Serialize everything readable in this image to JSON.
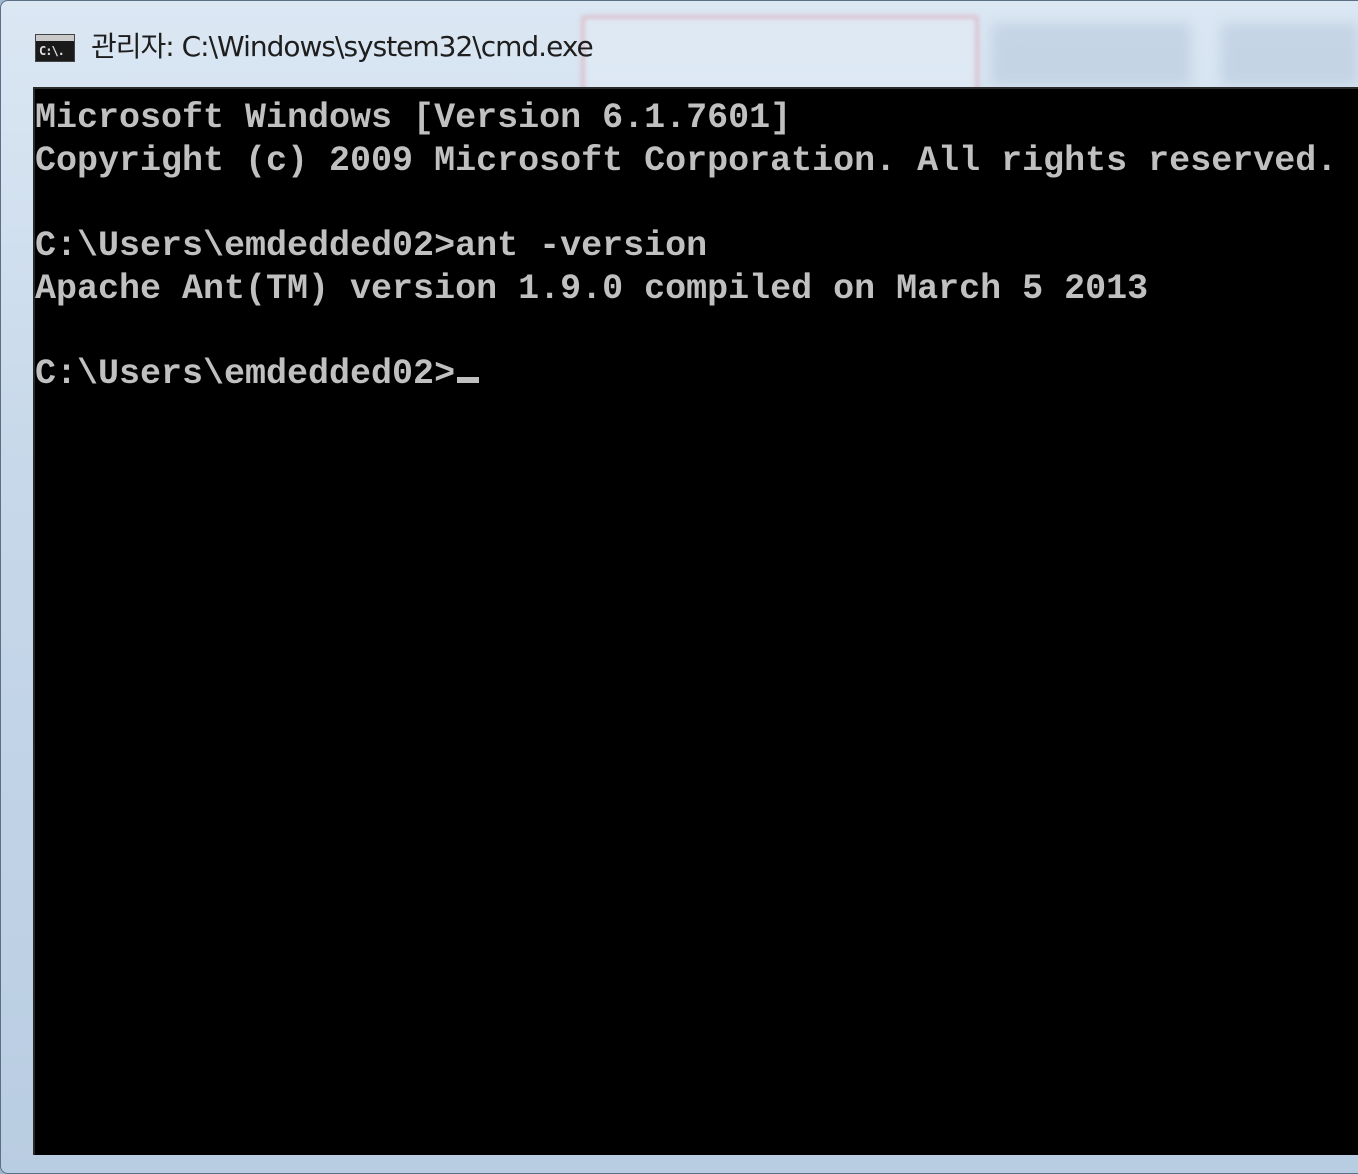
{
  "window": {
    "title": "관리자: C:\\Windows\\system32\\cmd.exe",
    "icon_text": "C:\\."
  },
  "console": {
    "lines": [
      "Microsoft Windows [Version 6.1.7601]",
      "Copyright (c) 2009 Microsoft Corporation. All rights reserved.",
      "",
      "C:\\Users\\emdedded02>ant -version",
      "Apache Ant(TM) version 1.9.0 compiled on March 5 2013",
      "",
      "C:\\Users\\emdedded02>"
    ],
    "foreground": "#c0c0c0",
    "background": "#000000"
  }
}
